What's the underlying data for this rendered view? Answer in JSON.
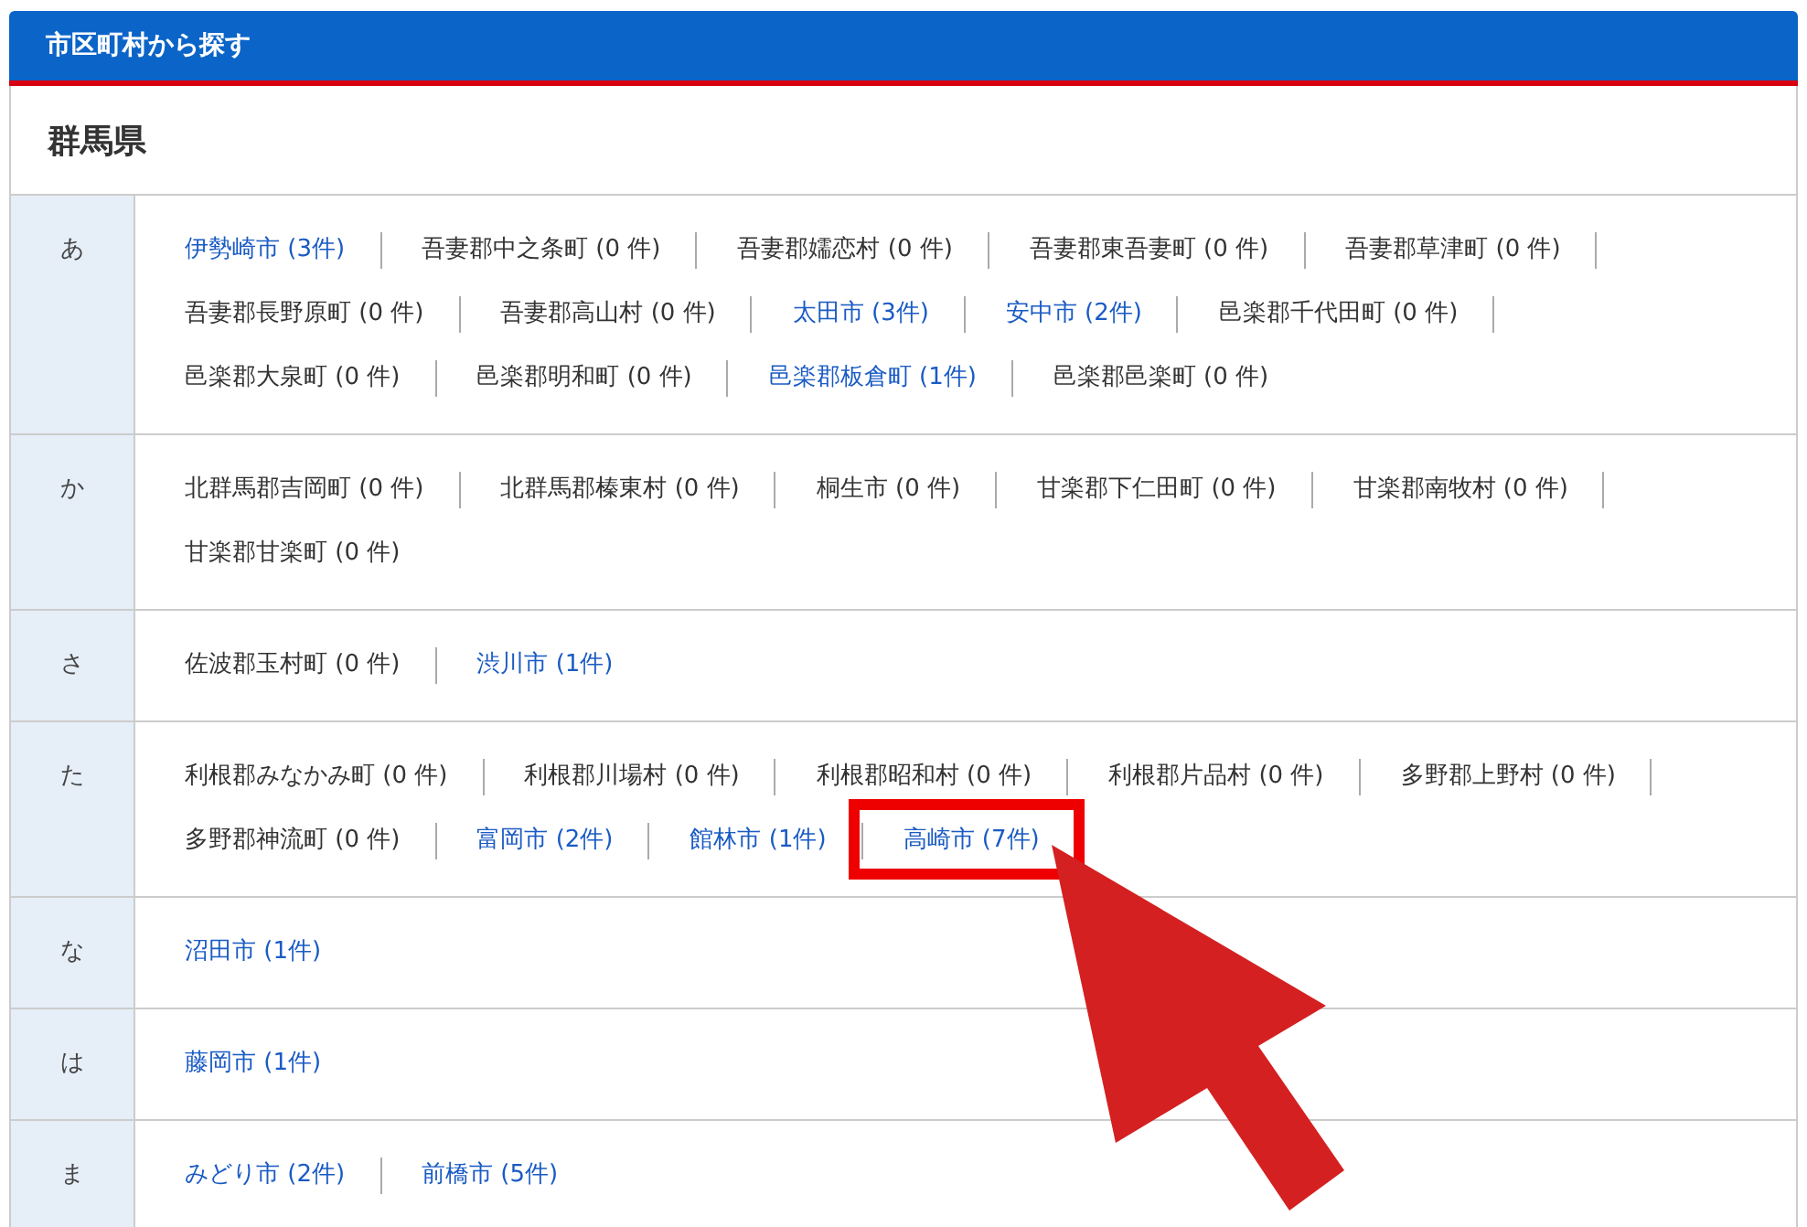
{
  "header": {
    "title": "市区町村から探す"
  },
  "prefecture": {
    "name": "群馬県"
  },
  "groups": [
    {
      "kana": "あ",
      "items": [
        {
          "label": "伊勢崎市 (3件)",
          "linked": true,
          "highlighted": false
        },
        {
          "label": "吾妻郡中之条町 (0 件)",
          "linked": false,
          "highlighted": false
        },
        {
          "label": "吾妻郡嬬恋村 (0 件)",
          "linked": false,
          "highlighted": false
        },
        {
          "label": "吾妻郡東吾妻町 (0 件)",
          "linked": false,
          "highlighted": false
        },
        {
          "label": "吾妻郡草津町 (0 件)",
          "linked": false,
          "highlighted": false
        },
        {
          "label": "吾妻郡長野原町 (0 件)",
          "linked": false,
          "highlighted": false
        },
        {
          "label": "吾妻郡高山村 (0 件)",
          "linked": false,
          "highlighted": false
        },
        {
          "label": "太田市 (3件)",
          "linked": true,
          "highlighted": false
        },
        {
          "label": "安中市 (2件)",
          "linked": true,
          "highlighted": false
        },
        {
          "label": "邑楽郡千代田町 (0 件)",
          "linked": false,
          "highlighted": false
        },
        {
          "label": "邑楽郡大泉町 (0 件)",
          "linked": false,
          "highlighted": false
        },
        {
          "label": "邑楽郡明和町 (0 件)",
          "linked": false,
          "highlighted": false
        },
        {
          "label": "邑楽郡板倉町 (1件)",
          "linked": true,
          "highlighted": false
        },
        {
          "label": "邑楽郡邑楽町 (0 件)",
          "linked": false,
          "highlighted": false
        }
      ]
    },
    {
      "kana": "か",
      "items": [
        {
          "label": "北群馬郡吉岡町 (0 件)",
          "linked": false,
          "highlighted": false
        },
        {
          "label": "北群馬郡榛東村 (0 件)",
          "linked": false,
          "highlighted": false
        },
        {
          "label": "桐生市 (0 件)",
          "linked": false,
          "highlighted": false
        },
        {
          "label": "甘楽郡下仁田町 (0 件)",
          "linked": false,
          "highlighted": false
        },
        {
          "label": "甘楽郡南牧村 (0 件)",
          "linked": false,
          "highlighted": false
        },
        {
          "label": "甘楽郡甘楽町 (0 件)",
          "linked": false,
          "highlighted": false
        }
      ]
    },
    {
      "kana": "さ",
      "items": [
        {
          "label": "佐波郡玉村町 (0 件)",
          "linked": false,
          "highlighted": false
        },
        {
          "label": "渋川市 (1件)",
          "linked": true,
          "highlighted": false
        }
      ]
    },
    {
      "kana": "た",
      "items": [
        {
          "label": "利根郡みなかみ町 (0 件)",
          "linked": false,
          "highlighted": false
        },
        {
          "label": "利根郡川場村 (0 件)",
          "linked": false,
          "highlighted": false
        },
        {
          "label": "利根郡昭和村 (0 件)",
          "linked": false,
          "highlighted": false
        },
        {
          "label": "利根郡片品村 (0 件)",
          "linked": false,
          "highlighted": false
        },
        {
          "label": "多野郡上野村 (0 件)",
          "linked": false,
          "highlighted": false
        },
        {
          "label": "多野郡神流町 (0 件)",
          "linked": false,
          "highlighted": false
        },
        {
          "label": "富岡市 (2件)",
          "linked": true,
          "highlighted": false
        },
        {
          "label": "館林市 (1件)",
          "linked": true,
          "highlighted": false
        },
        {
          "label": "高崎市 (7件)",
          "linked": true,
          "highlighted": true
        }
      ]
    },
    {
      "kana": "な",
      "items": [
        {
          "label": "沼田市 (1件)",
          "linked": true,
          "highlighted": false
        }
      ]
    },
    {
      "kana": "は",
      "items": [
        {
          "label": "藤岡市 (1件)",
          "linked": true,
          "highlighted": false
        }
      ]
    },
    {
      "kana": "ま",
      "items": [
        {
          "label": "みどり市 (2件)",
          "linked": true,
          "highlighted": false
        },
        {
          "label": "前橋市 (5件)",
          "linked": true,
          "highlighted": false
        }
      ]
    }
  ]
}
